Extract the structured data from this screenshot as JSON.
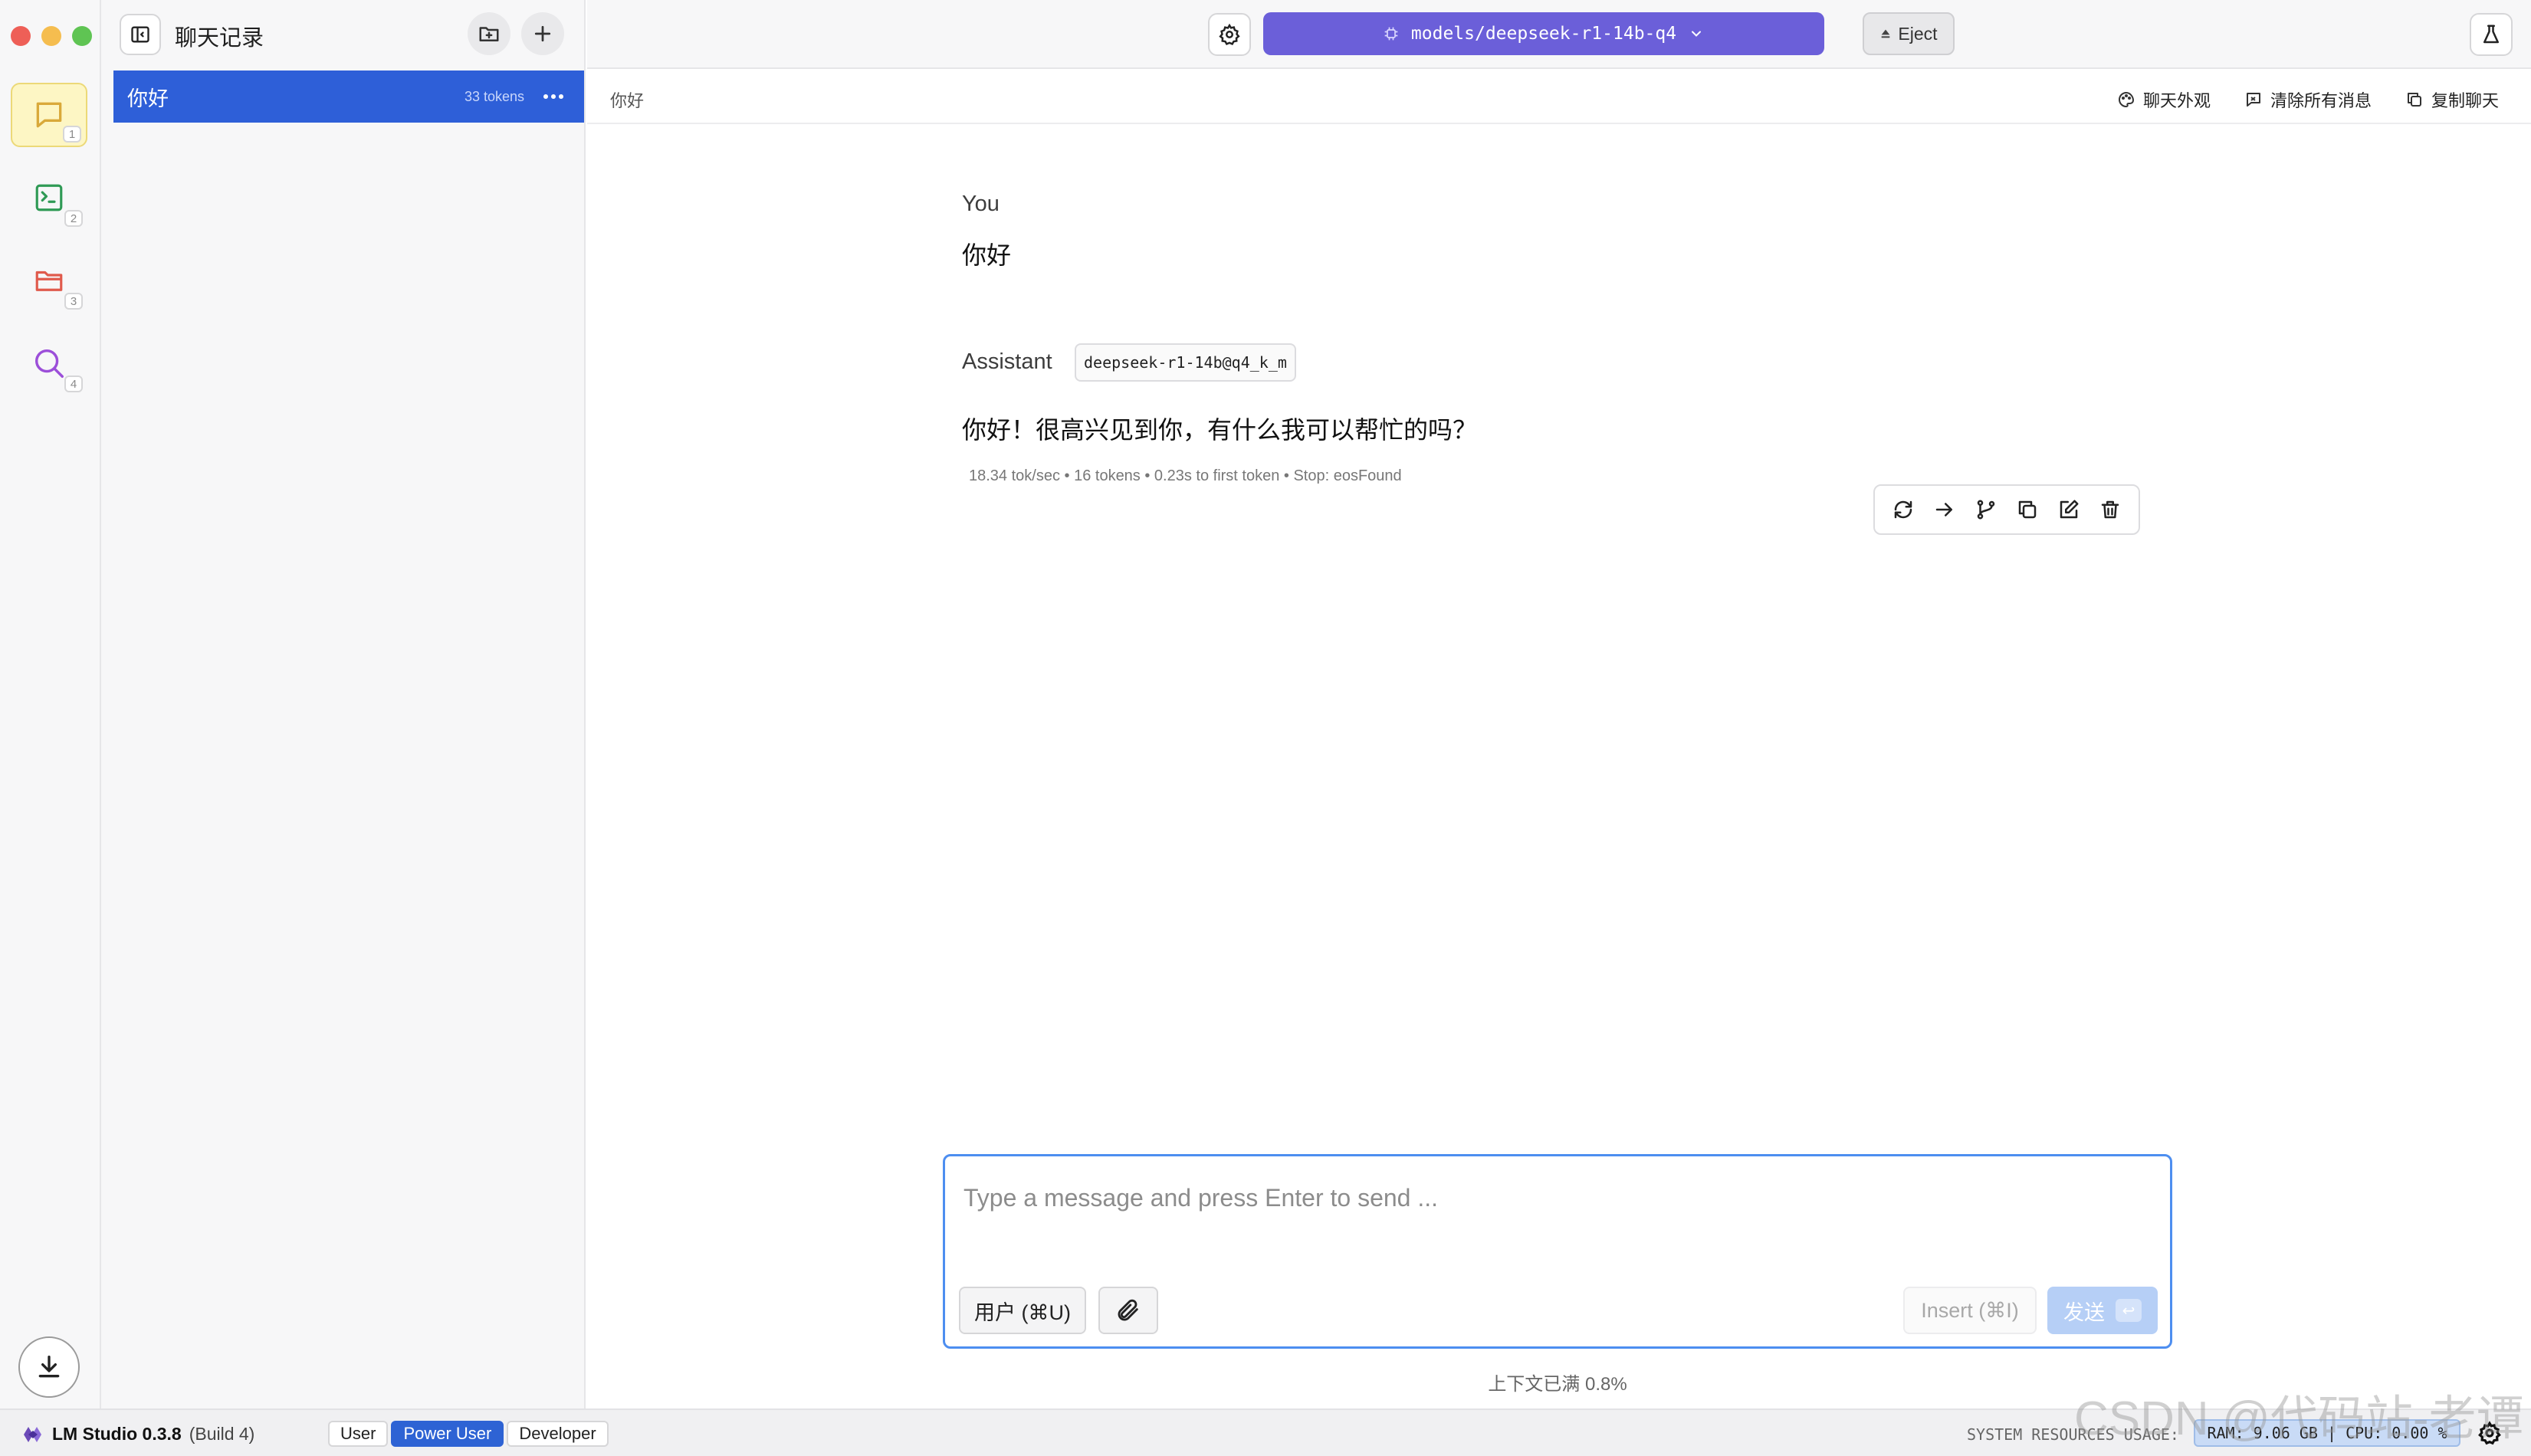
{
  "window": {
    "traffic_colors": [
      "#ee5f57",
      "#f5bd4f",
      "#5fc453"
    ]
  },
  "rail": {
    "items": [
      {
        "icon": "chat-bubble-icon",
        "number": "1",
        "color": "#d9a93a"
      },
      {
        "icon": "terminal-icon",
        "number": "2",
        "color": "#2f9a55"
      },
      {
        "icon": "folder-icon",
        "number": "3",
        "color": "#e05a4c"
      },
      {
        "icon": "search-icon",
        "number": "4",
        "color": "#9c4fd9"
      }
    ],
    "download_icon": "download-icon"
  },
  "chat_list": {
    "title": "聊天记录",
    "chats": [
      {
        "name": "你好",
        "tokens": "33 tokens"
      }
    ]
  },
  "topbar": {
    "model_name": "models/deepseek-r1-14b-q4",
    "eject_label": "Eject",
    "model_color": "#6b5fd9"
  },
  "subbar": {
    "chat_title": "你好",
    "appearance_label": "聊天外观",
    "clear_label": "清除所有消息",
    "copy_label": "复制聊天"
  },
  "conversation": {
    "user_role": "You",
    "user_message": "你好",
    "assistant_role": "Assistant",
    "assistant_model": "deepseek-r1-14b@q4_k_m",
    "assistant_message": "你好！很高兴见到你，有什么我可以帮忙的吗？",
    "stats": "18.34 tok/sec  •  16 tokens  •  0.23s to first token  •  Stop: eosFound"
  },
  "composer": {
    "placeholder": "Type a message and press Enter to send ...",
    "role_label": "用户 (⌘U)",
    "insert_label": "Insert (⌘I)",
    "send_label": "发送",
    "send_key": "↩",
    "context_info": "上下文已满 0.8%"
  },
  "statusbar": {
    "app_name": "LM Studio 0.3.8",
    "build": "(Build 4)",
    "modes": [
      "User",
      "Power User",
      "Developer"
    ],
    "active_mode": "Power User",
    "sys_label": "SYSTEM RESOURCES USAGE:",
    "sys_value": "RAM: 9.06 GB  |  CPU: 0.00 %",
    "watermark": "CSDN @代码站-老谭"
  }
}
